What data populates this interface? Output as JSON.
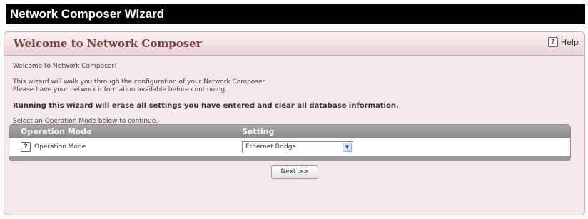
{
  "app": {
    "title": "Network Composer Wizard"
  },
  "panel": {
    "title": "Welcome to Network Composer",
    "help_label": "Help"
  },
  "content": {
    "welcome": "Welcome to Network Composer!",
    "intro_line1": "This wizard will walk you through the configuration of your Network Composer.",
    "intro_line2": "Please have your network information available before continuing.",
    "warning": "Running this wizard will erase all settings you have entered and clear all database information.",
    "instruction": "Select an Operation Mode below to continue."
  },
  "table": {
    "headers": [
      "Operation Mode",
      "Setting"
    ],
    "rows": [
      {
        "label": "Operation Mode",
        "value": "Ethernet Bridge"
      }
    ]
  },
  "buttons": {
    "next": "Next >>"
  },
  "icons": {
    "help": "question-mark-icon",
    "select_arrow": "chevron-down-icon"
  },
  "colors": {
    "title_bar": "#000000",
    "panel_title": "#7a3c40",
    "panel_bg": "#f3e9ea",
    "table_header": "#9b9b9b"
  }
}
